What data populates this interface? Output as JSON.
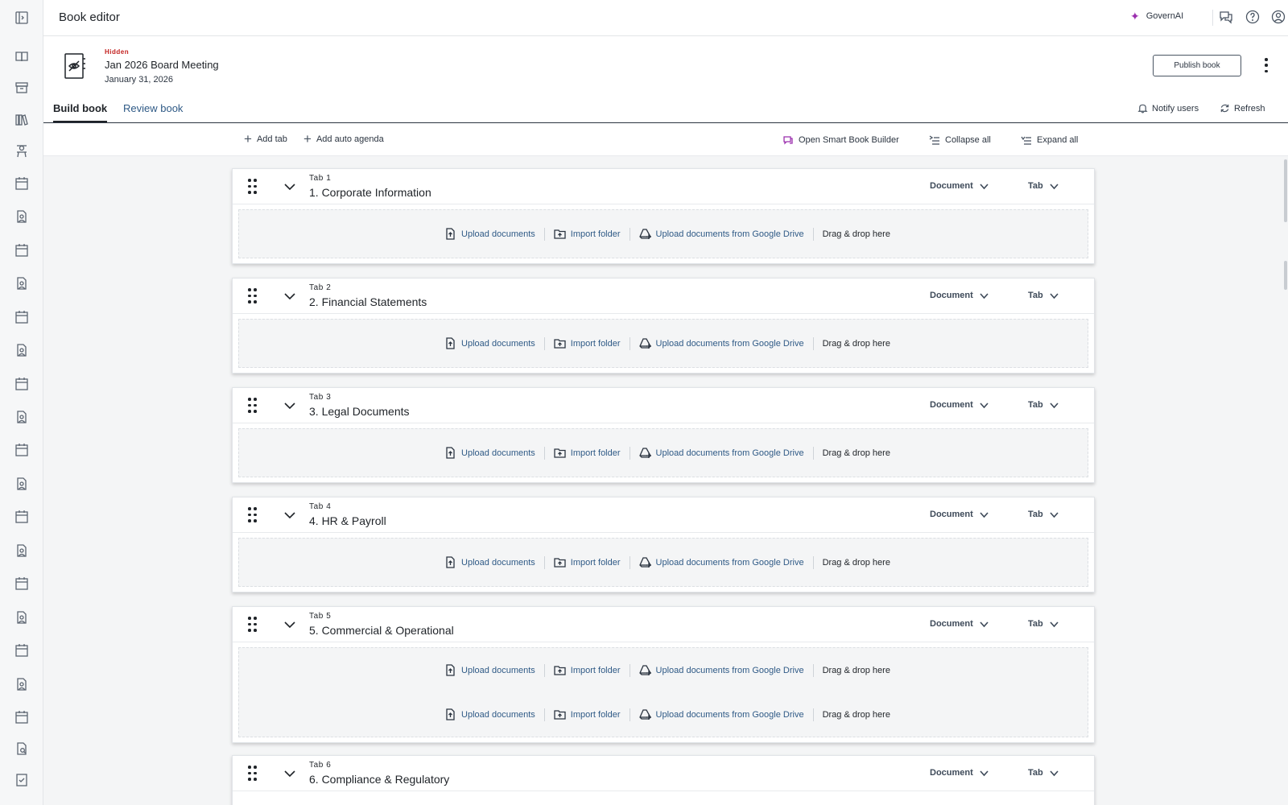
{
  "app": {
    "title": "Book editor",
    "ai_label": "GovernAI"
  },
  "book": {
    "status": "Hidden",
    "title": "Jan 2026 Board Meeting",
    "date": "January 31, 2026",
    "publish_label": "Publish book"
  },
  "tabs": {
    "build": "Build book",
    "review": "Review book",
    "notify": "Notify users",
    "refresh": "Refresh"
  },
  "toolbar": {
    "add_tab": "Add tab",
    "add_auto_agenda": "Add auto agenda",
    "smart_builder": "Open Smart Book Builder",
    "collapse_all": "Collapse all",
    "expand_all": "Expand all"
  },
  "dropzone": {
    "upload": "Upload documents",
    "import": "Import folder",
    "gdrive": "Upload documents from Google Drive",
    "drag": "Drag & drop here"
  },
  "sections": [
    {
      "num": "Tab 1",
      "title": "1. Corporate Information",
      "doc_select": "Document",
      "tab_select": "Tab"
    },
    {
      "num": "Tab 2",
      "title": "2. Financial Statements",
      "doc_select": "Document",
      "tab_select": "Tab"
    },
    {
      "num": "Tab 3",
      "title": "3. Legal Documents",
      "doc_select": "Document",
      "tab_select": "Tab"
    },
    {
      "num": "Tab 4",
      "title": "4. HR & Payroll",
      "doc_select": "Document",
      "tab_select": "Tab"
    },
    {
      "num": "Tab 5",
      "title": "5. Commercial & Operational",
      "doc_select": "Document",
      "tab_select": "Tab"
    },
    {
      "num": "Tab 6",
      "title": "6. Compliance & Regulatory",
      "doc_select": "Document",
      "tab_select": "Tab"
    }
  ],
  "colors": {
    "accent_link": "#2f5a86",
    "hidden_red": "#c3211f",
    "ai_purple": "#9b2fae"
  },
  "icons": [
    "sidebar-toggle-icon",
    "book-open-icon",
    "archive-icon",
    "library-icon",
    "meeting-icon",
    "calendar-icon",
    "person-doc-icon",
    "document-search-icon",
    "checklist-icon"
  ]
}
